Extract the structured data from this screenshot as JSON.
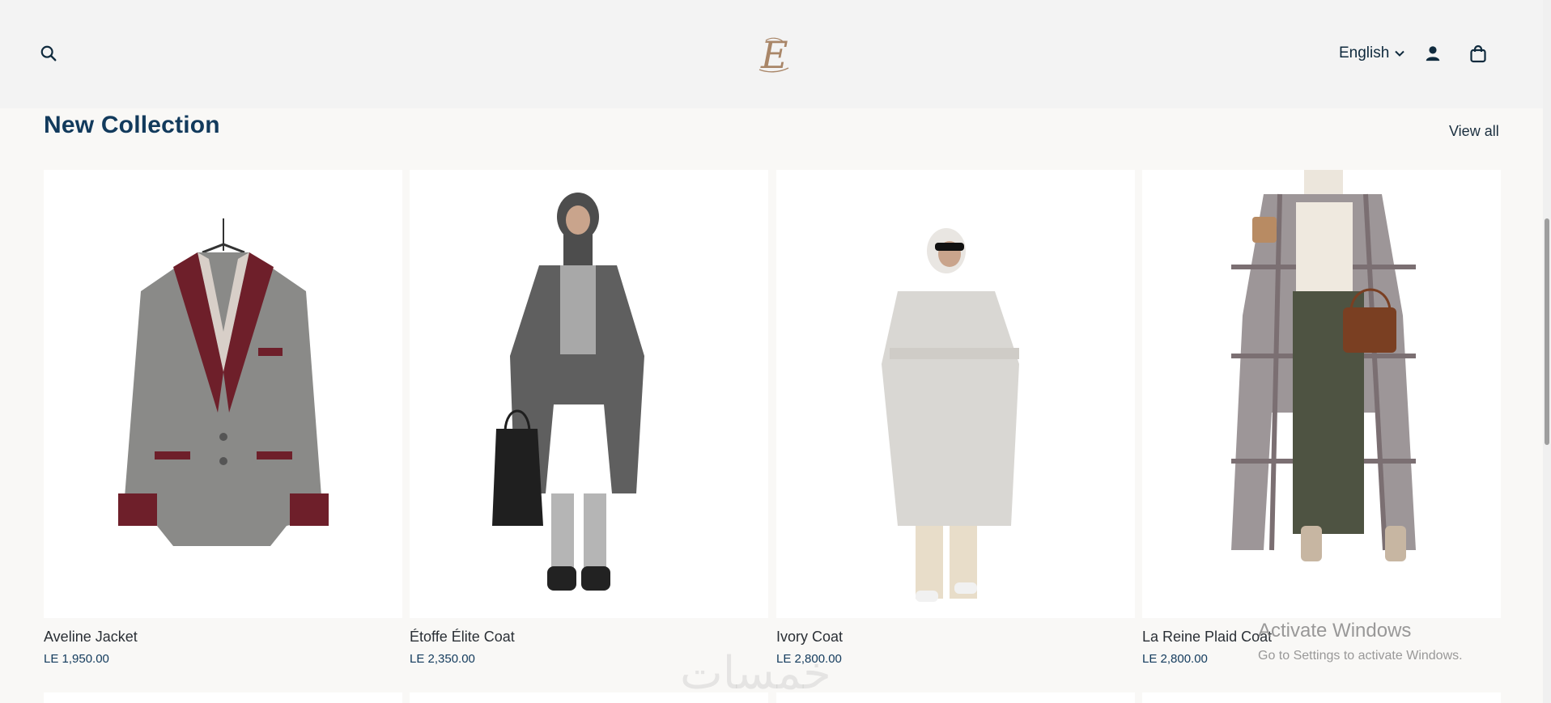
{
  "header": {
    "language_label": "English",
    "icons": {
      "search": "search-icon",
      "account": "user-icon",
      "cart": "shopping-bag-icon",
      "language_caret": "chevron-down-icon"
    },
    "logo_letter": "E"
  },
  "section": {
    "title": "New Collection",
    "view_all_label": "View all"
  },
  "products": [
    {
      "name": "Aveline Jacket",
      "price": "LE 1,950.00"
    },
    {
      "name": "Étoffe Élite Coat",
      "price": "LE 2,350.00"
    },
    {
      "name": "Ivory Coat",
      "price": "LE 2,800.00"
    },
    {
      "name": "La Reine Plaid Coat",
      "price": "LE 2,800.00"
    }
  ],
  "overlay": {
    "activate_title": "Activate Windows",
    "activate_subtitle": "Go to Settings to activate Windows.",
    "watermark_text": "خمسات"
  },
  "colors": {
    "header_bg": "#f3f3f3",
    "page_bg": "#f9f8f6",
    "title_color": "#123a5c"
  }
}
